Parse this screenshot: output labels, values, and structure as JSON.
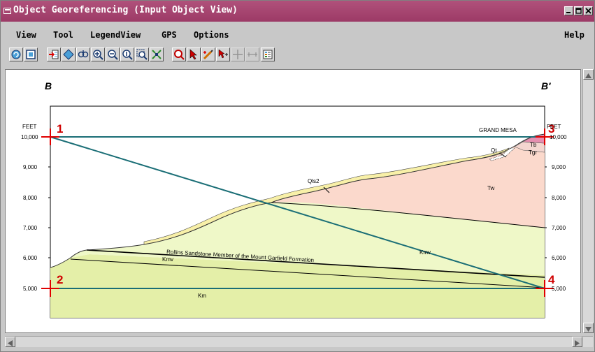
{
  "window": {
    "title": "Object Georeferencing (Input Object View)",
    "controls": [
      "minimize-icon",
      "maximize-icon",
      "close-icon"
    ]
  },
  "menu": {
    "items": [
      "View",
      "Tool",
      "LegendView",
      "GPS",
      "Options"
    ],
    "help": "Help"
  },
  "toolbar": {
    "buttons": [
      {
        "name": "redraw-icon",
        "enabled": true
      },
      {
        "name": "full-view-icon",
        "enabled": true
      },
      {
        "name": "georeference-add-icon",
        "enabled": true
      },
      {
        "name": "diamond-icon",
        "enabled": true
      },
      {
        "name": "pan-icon",
        "enabled": true
      },
      {
        "name": "zoom-in-icon",
        "enabled": true
      },
      {
        "name": "zoom-out-icon",
        "enabled": true
      },
      {
        "name": "zoom-1x-icon",
        "enabled": true
      },
      {
        "name": "zoom-box-icon",
        "enabled": true
      },
      {
        "name": "zoom-full-icon",
        "enabled": true
      },
      {
        "name": "examine-icon",
        "enabled": true
      },
      {
        "name": "select-icon",
        "enabled": true
      },
      {
        "name": "edit-point-icon",
        "enabled": true
      },
      {
        "name": "select-point-icon",
        "enabled": true
      },
      {
        "name": "crosshair-icon",
        "enabled": false
      },
      {
        "name": "measure-icon",
        "enabled": false
      },
      {
        "name": "legend-icon",
        "enabled": true
      }
    ]
  },
  "section": {
    "left_label": "B",
    "right_label": "B′",
    "unit_left": "FEET",
    "unit_right": "FEET",
    "elevation_ticks": [
      "10,000",
      "9,000",
      "8,000",
      "7,000",
      "6,000",
      "5,000"
    ],
    "units": {
      "grand_mesa": "GRAND MESA",
      "tb": "Tb",
      "tgr": "Tgr",
      "qt": "Qt",
      "tw": "Tw",
      "qls2": "Qls2",
      "kmv_right": "Kmv",
      "kmv_left": "Kmv",
      "rollins": "Rollins Sandstone Member of the Mount Garfield Formation",
      "km": "Km"
    },
    "colors": {
      "km": "#e4efa8",
      "kmv": "#eff8c8",
      "tw": "#fbd9cc",
      "qls": "#f8f0a8",
      "tb": "#e68fb0",
      "tgr": "#f4d6d0",
      "control_line": "#1a6e76",
      "control_mark": "#e00000"
    }
  },
  "control_points": [
    "1",
    "2",
    "3",
    "4"
  ]
}
